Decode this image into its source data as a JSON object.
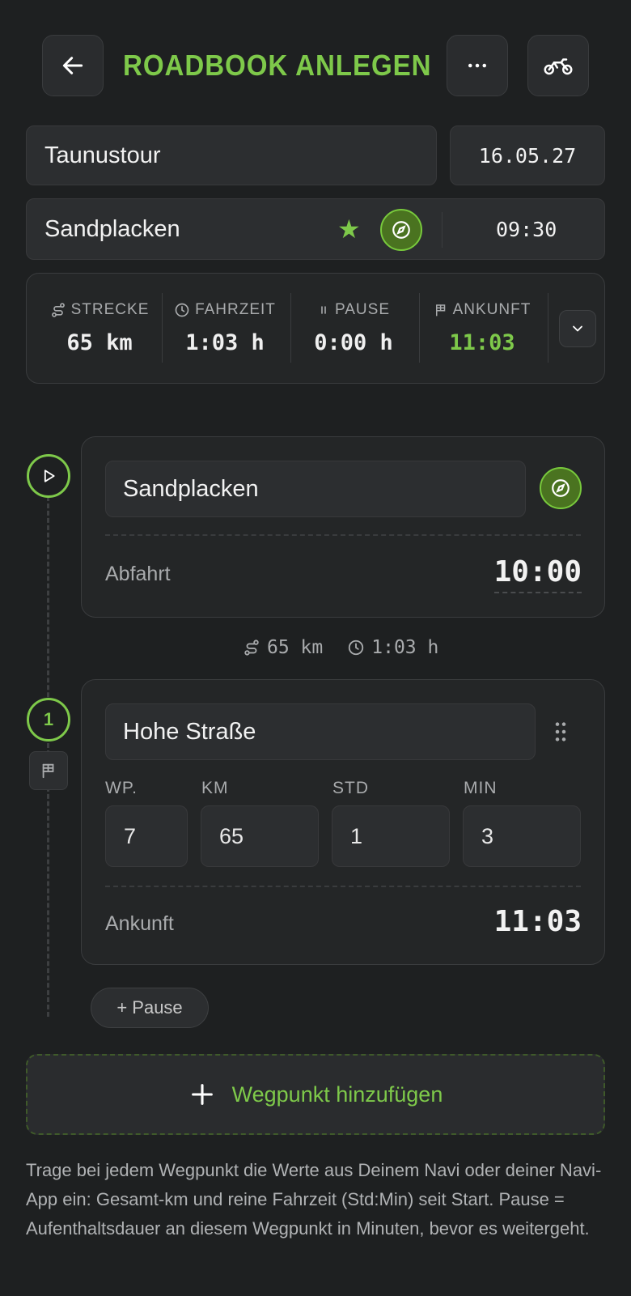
{
  "header": {
    "title": "ROADBOOK ANLEGEN",
    "back_icon": "arrow-left-icon",
    "more_icon": "more-horizontal-icon",
    "vehicle_icon": "motorcycle-icon"
  },
  "tour": {
    "name": "Taunustour",
    "date": "16.05.27",
    "start_location": "Sandplacken",
    "start_time": "09:30"
  },
  "summary": {
    "distance_label": "STRECKE",
    "distance_value": "65 km",
    "drive_label": "FAHRZEIT",
    "drive_value": "1:03 h",
    "pause_label": "PAUSE",
    "pause_value": "0:00 h",
    "arrival_label": "ANKUNFT",
    "arrival_value": "11:03"
  },
  "start_point": {
    "name": "Sandplacken",
    "departure_label": "Abfahrt",
    "departure_time": "10:00"
  },
  "segment": {
    "distance": "65 km",
    "duration": "1:03 h"
  },
  "waypoint_1": {
    "index": "1",
    "name": "Hohe Straße",
    "wp_label": "WP.",
    "km_label": "KM",
    "std_label": "STD",
    "min_label": "MIN",
    "wp_value": "7",
    "km_value": "65",
    "std_value": "1",
    "min_value": "3",
    "arrival_label": "Ankunft",
    "arrival_time": "11:03"
  },
  "actions": {
    "pause_button": "+ Pause",
    "add_waypoint": "Wegpunkt hinzufügen"
  },
  "help_text": "Trage bei jedem Wegpunkt die Werte aus Deinem Navi oder deiner Navi-App ein: Gesamt-km und reine Fahrzeit (Std:Min) seit Start. Pause = Aufenthaltsdauer an diesem Wegpunkt in Minuten, bevor es weitergeht.",
  "colors": {
    "accent": "#7ec94a",
    "background": "#1e2021",
    "card": "#242627"
  }
}
